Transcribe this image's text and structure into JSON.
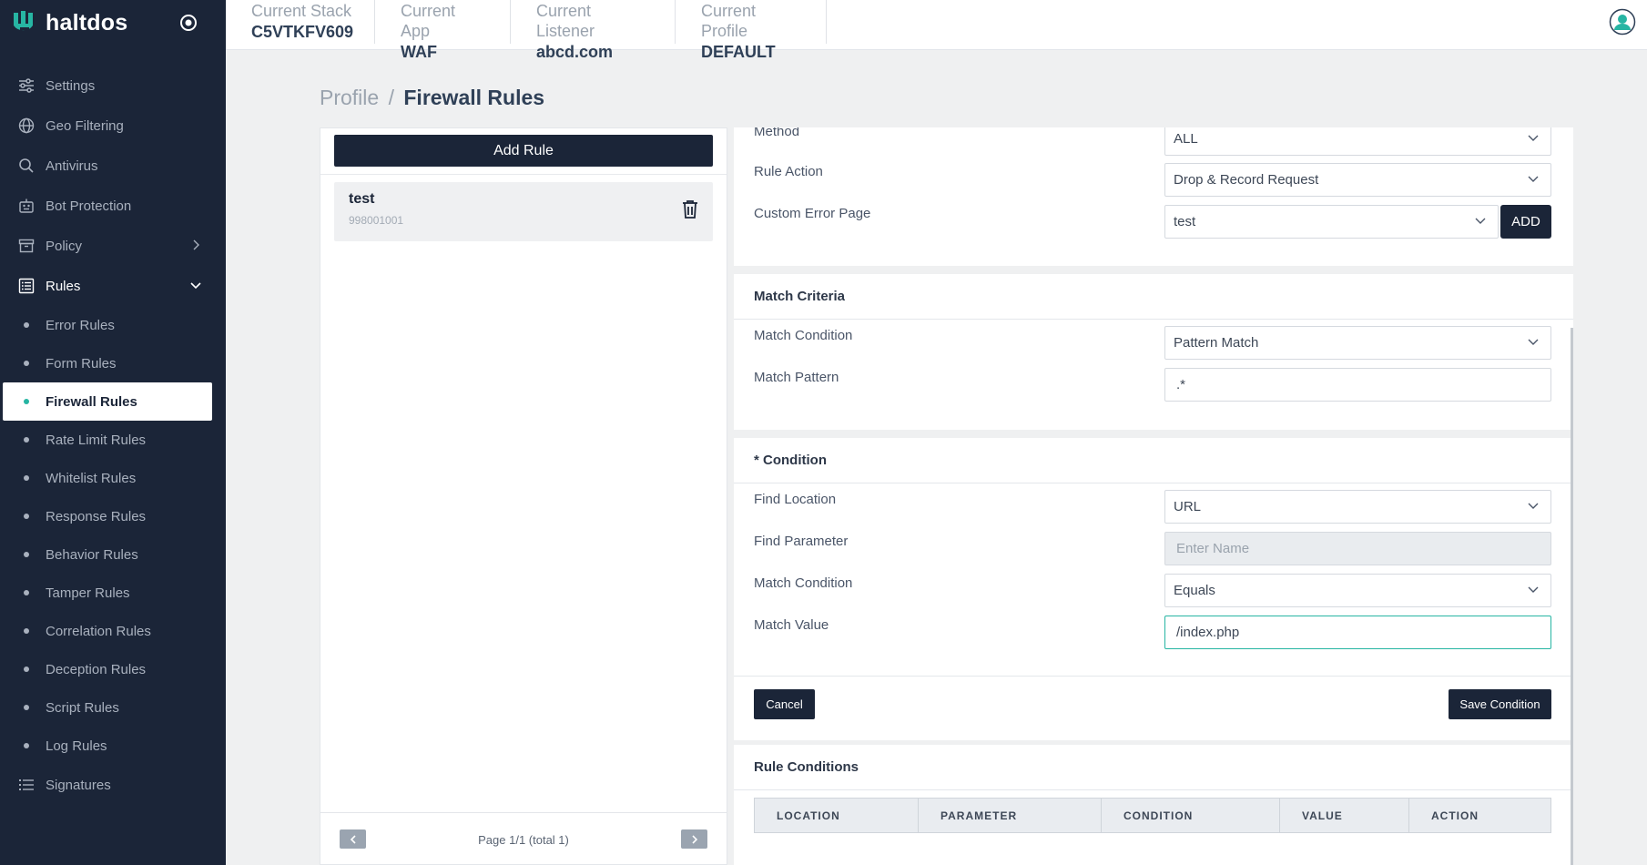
{
  "brand": {
    "name": "haltdos"
  },
  "sidebar": {
    "items": [
      {
        "label": "Settings",
        "icon": "sliders-icon"
      },
      {
        "label": "Geo Filtering",
        "icon": "globe-icon"
      },
      {
        "label": "Antivirus",
        "icon": "search-icon"
      },
      {
        "label": "Bot Protection",
        "icon": "robot-icon"
      },
      {
        "label": "Policy",
        "icon": "archive-icon"
      },
      {
        "label": "Rules",
        "icon": "list-icon"
      }
    ],
    "rules_sub": [
      "Error Rules",
      "Form Rules",
      "Firewall Rules",
      "Rate Limit Rules",
      "Whitelist Rules",
      "Response Rules",
      "Behavior Rules",
      "Tamper Rules",
      "Correlation Rules",
      "Deception Rules",
      "Script Rules",
      "Log Rules"
    ],
    "signatures": "Signatures",
    "active_item": "Firewall Rules",
    "accent_color": "#27b5a3"
  },
  "topbar": {
    "stack": {
      "label": "Current Stack",
      "value": "C5VTKFV609"
    },
    "app": {
      "label": "Current App",
      "value": "WAF"
    },
    "listener": {
      "label": "Current Listener",
      "value": "abcd.com"
    },
    "profile": {
      "label": "Current Profile",
      "value": "DEFAULT"
    }
  },
  "breadcrumb": {
    "parent": "Profile",
    "separator": "/",
    "current": "Firewall Rules"
  },
  "left_panel": {
    "add_rule_label": "Add Rule",
    "rules": [
      {
        "name": "test",
        "id": "998001001"
      }
    ],
    "pager_text": "Page 1/1 (total 1)"
  },
  "rule_settings": {
    "method_label": "Method",
    "method_value": "ALL",
    "action_label": "Rule Action",
    "action_value": "Drop & Record Request",
    "error_page_label": "Custom Error Page",
    "error_page_value": "test",
    "add_label": "ADD"
  },
  "match_criteria": {
    "title": "Match Criteria",
    "condition_label": "Match Condition",
    "condition_value": "Pattern Match",
    "pattern_label": "Match Pattern",
    "pattern_value": ".*"
  },
  "condition": {
    "title": "* Condition",
    "location_label": "Find Location",
    "location_value": "URL",
    "parameter_label": "Find Parameter",
    "parameter_placeholder": "Enter Name",
    "match_label": "Match Condition",
    "match_value": "Equals",
    "value_label": "Match Value",
    "value_value": "/index.php",
    "cancel_label": "Cancel",
    "save_label": "Save Condition"
  },
  "rule_conditions": {
    "title": "Rule Conditions",
    "columns": [
      "LOCATION",
      "PARAMETER",
      "CONDITION",
      "VALUE",
      "ACTION"
    ]
  }
}
